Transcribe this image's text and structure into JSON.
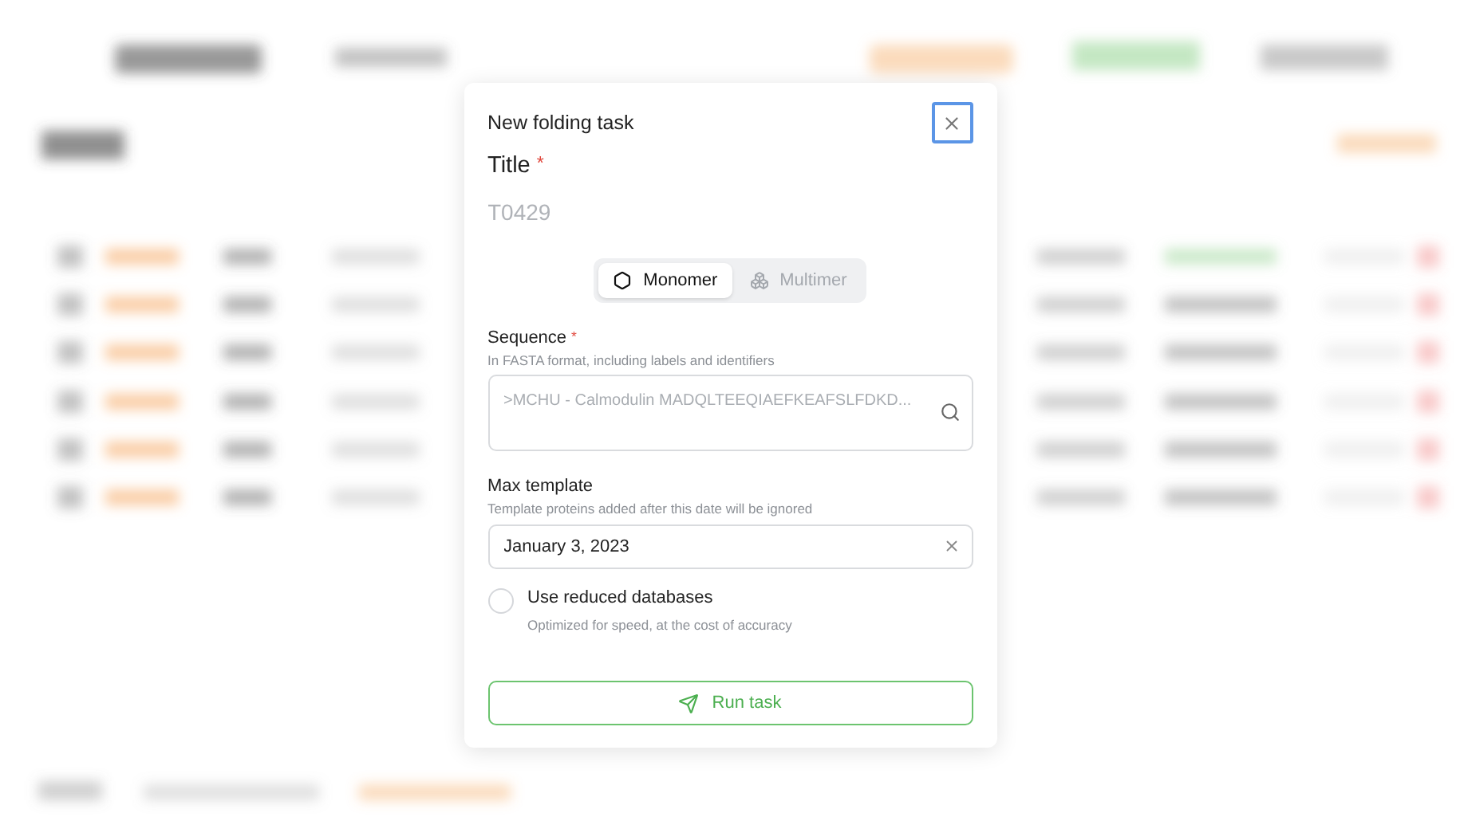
{
  "dialog": {
    "title": "New folding task"
  },
  "title_field": {
    "label": "Title",
    "required_mark": "*",
    "placeholder": "T0429"
  },
  "mode_toggle": [
    {
      "label": "Monomer",
      "kind": "monomer",
      "selected": true
    },
    {
      "label": "Multimer",
      "kind": "multimer",
      "selected": false
    }
  ],
  "sequence_field": {
    "label": "Sequence",
    "required_mark": "*",
    "hint": "In FASTA format, including labels and identifiers",
    "placeholder": ">MCHU - Calmodulin MADQLTEEQIAEFKEAFSLFDKD..."
  },
  "max_template_field": {
    "label": "Max template",
    "hint": "Template proteins added after this date will be ignored",
    "value": "January 3, 2023"
  },
  "reduced_databases": {
    "label": "Use reduced databases",
    "hint": "Optimized for speed, at the cost of accuracy",
    "checked": false
  },
  "submit_button": {
    "label": "Run task"
  }
}
